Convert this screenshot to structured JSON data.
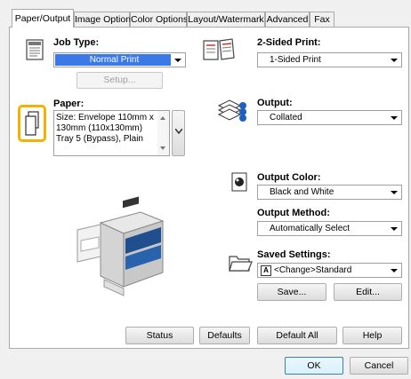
{
  "tabs": [
    {
      "label": "Paper/Output"
    },
    {
      "label": "Image Options"
    },
    {
      "label": "Color Options"
    },
    {
      "label": "Layout/Watermark"
    },
    {
      "label": "Advanced"
    },
    {
      "label": "Fax"
    }
  ],
  "job_type": {
    "label": "Job Type:",
    "value": "Normal Print",
    "setup_label": "Setup..."
  },
  "two_sided": {
    "label": "2-Sided Print:",
    "value": "1-Sided Print"
  },
  "paper": {
    "label": "Paper:",
    "info": "Size: Envelope 110mm x 130mm (110x130mm)\nTray 5 (Bypass), Plain"
  },
  "output": {
    "label": "Output:",
    "value": "Collated"
  },
  "output_color": {
    "label": "Output Color:",
    "value": "Black and White"
  },
  "output_method": {
    "label": "Output Method:",
    "value": "Automatically Select"
  },
  "saved_settings": {
    "label": "Saved Settings:",
    "value": "<Change>Standard",
    "save_label": "Save...",
    "edit_label": "Edit..."
  },
  "bottom_buttons": {
    "status": "Status",
    "defaults": "Defaults",
    "default_all": "Default All",
    "help": "Help"
  },
  "dialog_buttons": {
    "ok": "OK",
    "cancel": "Cancel"
  },
  "colors": {
    "highlight": "#f5b100",
    "selection": "#3a79e6"
  }
}
